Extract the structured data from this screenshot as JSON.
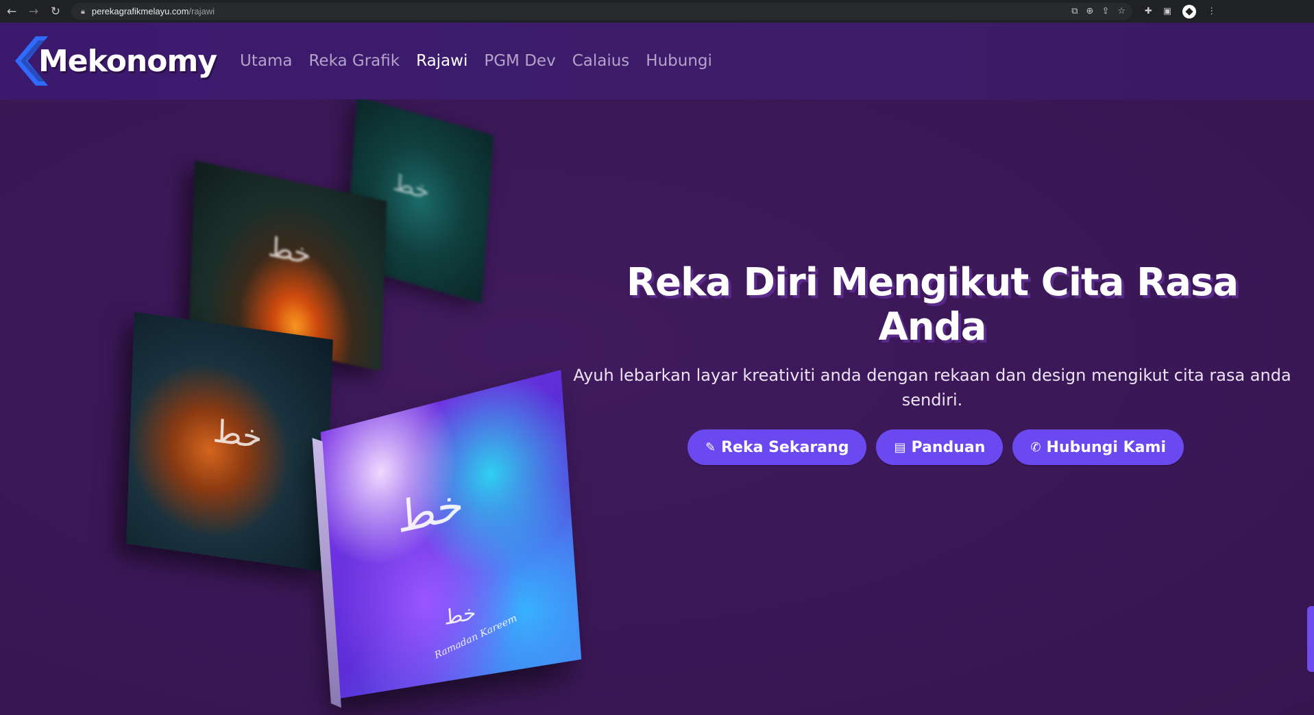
{
  "browser": {
    "url_host": "perekagrafikmelayu.com",
    "url_path": "/rajawi",
    "icons": [
      "back-icon",
      "forward-icon",
      "reload-icon",
      "lock-icon",
      "translate-icon",
      "zoom-icon",
      "share-icon",
      "bookmark-star-icon",
      "extensions-icon",
      "sidepanel-icon",
      "profile-icon",
      "menu-kebab-icon"
    ]
  },
  "header": {
    "logo_text": "Mekonomy",
    "nav": [
      {
        "label": "Utama",
        "active": false
      },
      {
        "label": "Reka Grafik",
        "active": false
      },
      {
        "label": "Rajawi",
        "active": true
      },
      {
        "label": "PGM Dev",
        "active": false
      },
      {
        "label": "Calaius",
        "active": false
      },
      {
        "label": "Hubungi",
        "active": false
      }
    ]
  },
  "hero": {
    "title": "Reka Diri Mengikut Cita Rasa Anda",
    "subtitle": "Ayuh lebarkan layar kreativiti anda dengan rekaan dan design mengikut cita rasa anda sendiri.",
    "buttons": [
      {
        "label": "Reka Sekarang",
        "icon": "edit-icon"
      },
      {
        "label": "Panduan",
        "icon": "document-icon"
      },
      {
        "label": "Hubungi Kami",
        "icon": "phone-icon"
      }
    ],
    "book_caption": "Ramadan Kareem"
  },
  "colors": {
    "background": "#3a1852",
    "header": "#3d1c6c",
    "accent_button": "#6a4af0",
    "nav_inactive": "#b4a3c9",
    "nav_active": "#ffffff"
  }
}
